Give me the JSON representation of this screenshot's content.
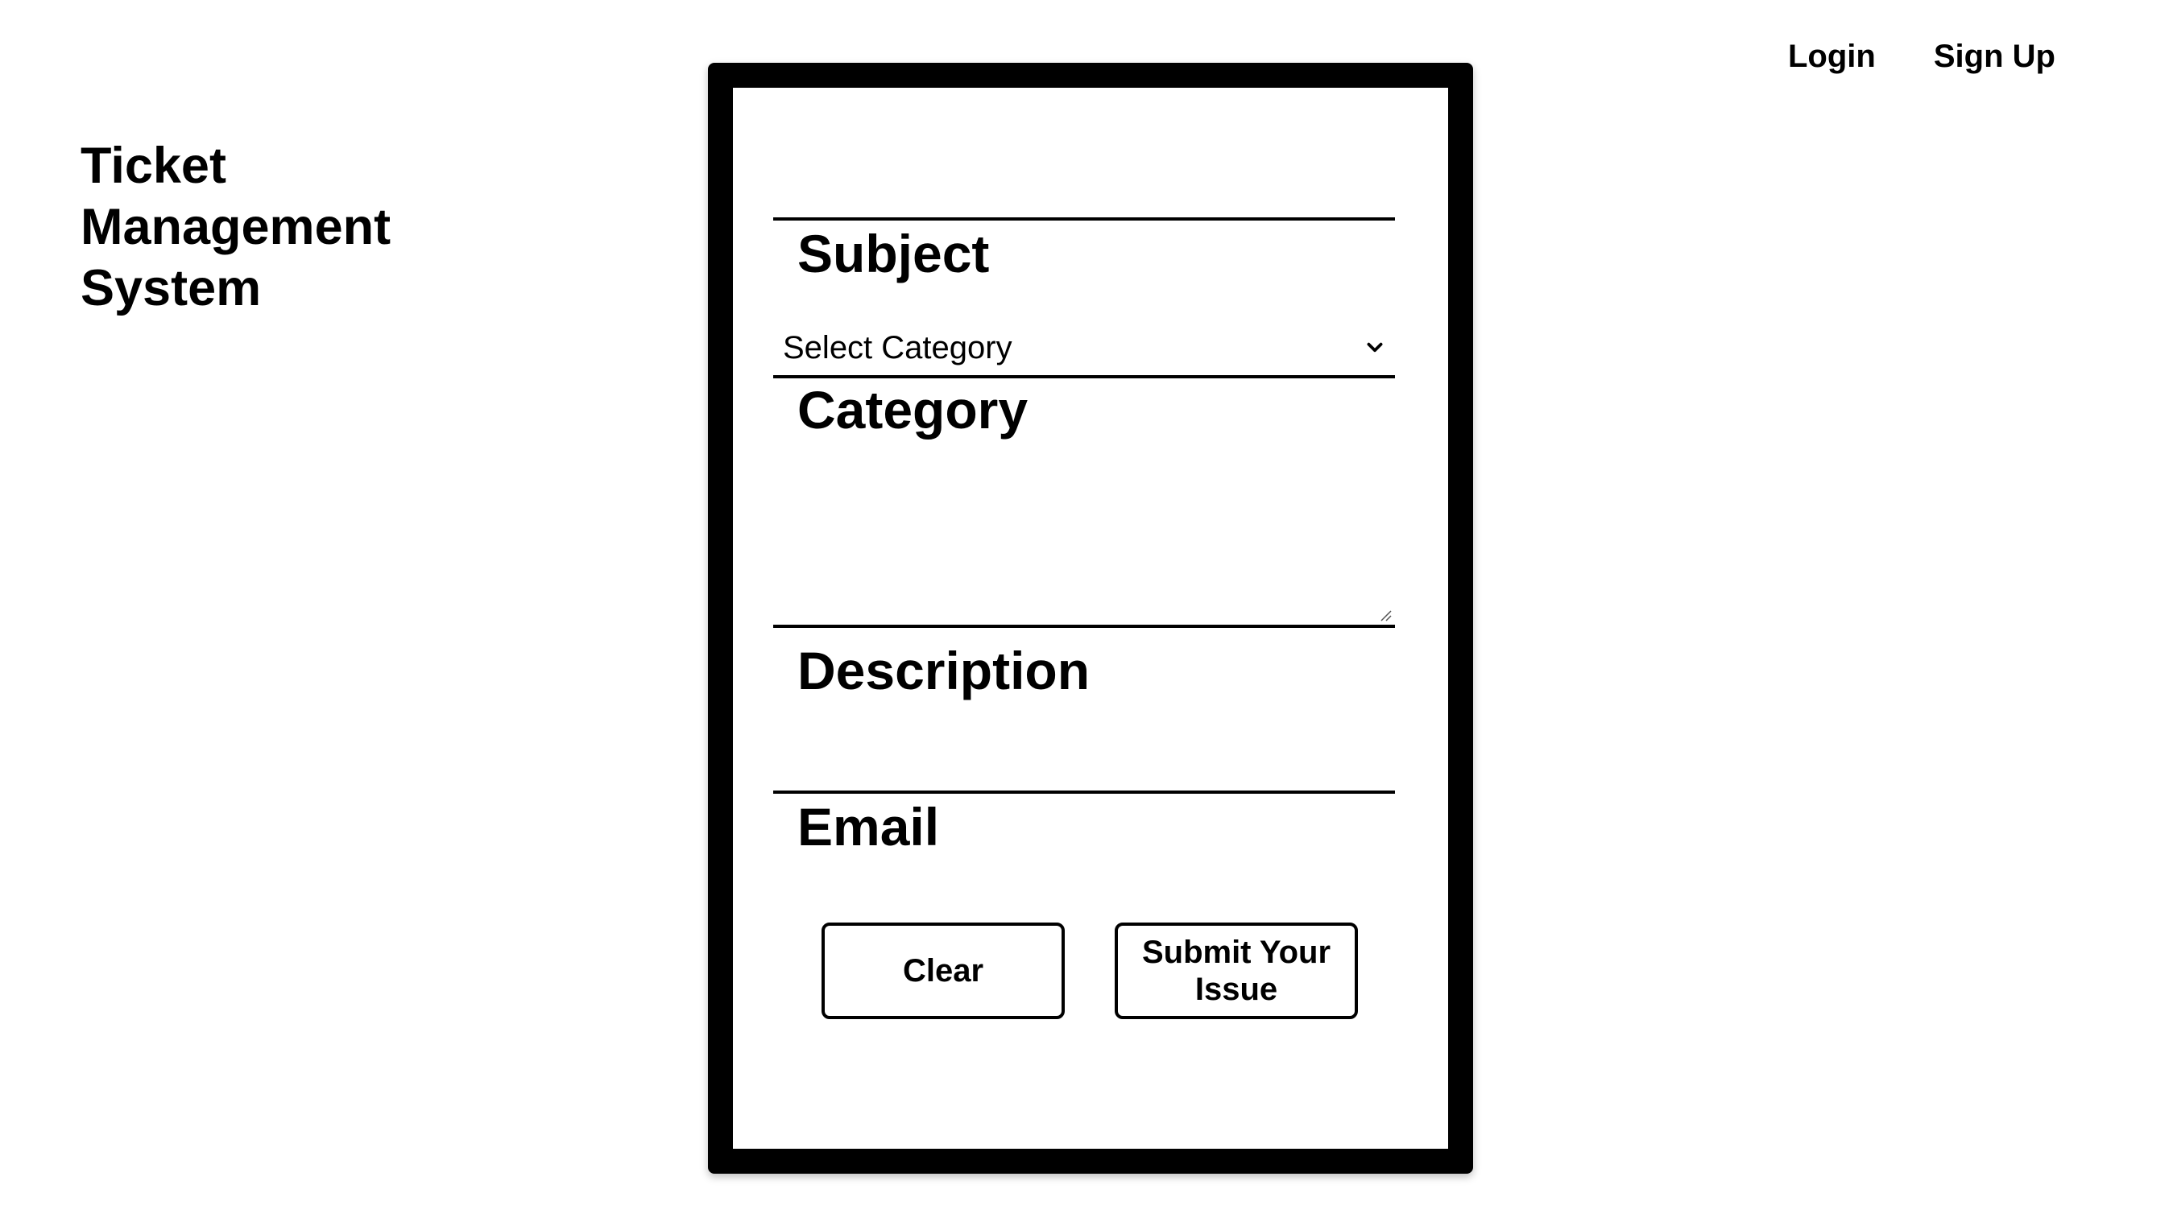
{
  "brand": {
    "title": "Ticket Management System"
  },
  "nav": {
    "login": "Login",
    "signup": "Sign Up"
  },
  "form": {
    "subject": {
      "label": "Subject",
      "value": ""
    },
    "category": {
      "label": "Category",
      "selected": "Select Category"
    },
    "description": {
      "label": "Description",
      "value": ""
    },
    "email": {
      "label": "Email",
      "value": ""
    },
    "buttons": {
      "clear": "Clear",
      "submit": "Submit Your Issue"
    }
  },
  "icons": {
    "category_select": "chevron-down-icon",
    "description_resize": "resize-grip-icon"
  }
}
